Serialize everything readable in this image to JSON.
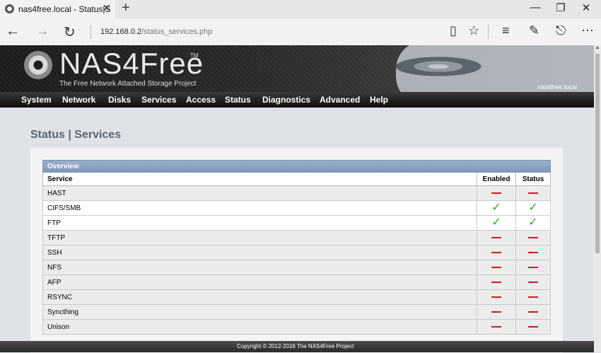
{
  "browser": {
    "tab_title": "nas4free.local - Status|S",
    "url_host": "192.168.0.2",
    "url_path": "/status_services.php"
  },
  "header": {
    "logo": "NAS4Free",
    "trademark": "TM",
    "tagline": "The Free Network Attached Storage Project",
    "hostname": "nas4free.local"
  },
  "menu": [
    "System",
    "Network",
    "Disks",
    "Services",
    "Access",
    "Status",
    "Diagnostics",
    "Advanced",
    "Help"
  ],
  "page_title": "Status | Services",
  "table": {
    "section": "Overview",
    "col_service": "Service",
    "col_enabled": "Enabled",
    "col_status": "Status",
    "rows": [
      {
        "name": "HAST",
        "enabled": false,
        "status": false
      },
      {
        "name": "CIFS/SMB",
        "enabled": true,
        "status": true
      },
      {
        "name": "FTP",
        "enabled": true,
        "status": true
      },
      {
        "name": "TFTP",
        "enabled": false,
        "status": false
      },
      {
        "name": "SSH",
        "enabled": false,
        "status": false
      },
      {
        "name": "NFS",
        "enabled": false,
        "status": false
      },
      {
        "name": "AFP",
        "enabled": false,
        "status": false
      },
      {
        "name": "RSYNC",
        "enabled": false,
        "status": false
      },
      {
        "name": "Syncthing",
        "enabled": false,
        "status": false
      },
      {
        "name": "Unison",
        "enabled": false,
        "status": false
      }
    ]
  },
  "footer": "Copyright © 2012-2016 The NAS4Free Project",
  "colors": {
    "accent": "#7e97b8",
    "enabled_check": "#3aa12c",
    "disabled_dash": "#c41f1f"
  }
}
